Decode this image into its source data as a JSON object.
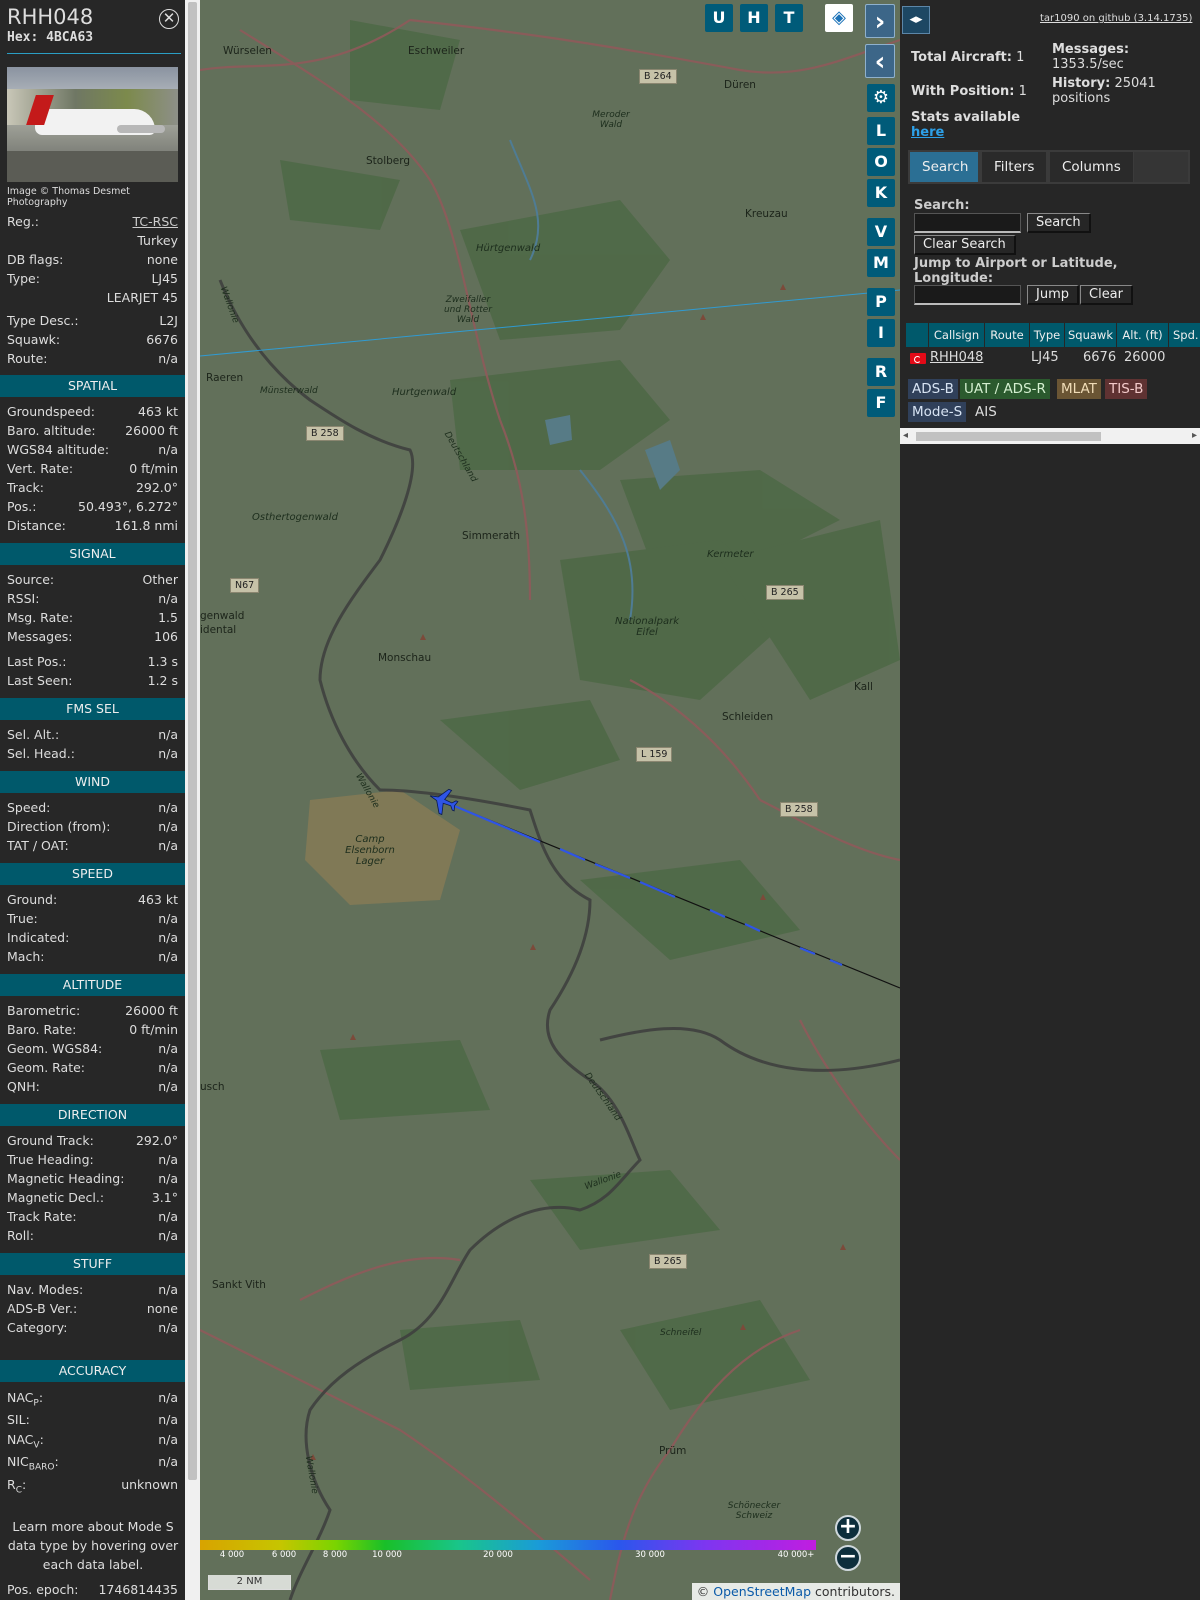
{
  "left_panel": {
    "callsign": "RHH048",
    "hex": "Hex: 4BCA63",
    "close_glyph": "✕",
    "photo_credit": "Image © Thomas Desmet Photography",
    "reg_label": "Reg.:",
    "reg_value": "TC-RSC",
    "country": "Turkey",
    "dbflags_label": "DB flags:",
    "dbflags_value": "none",
    "type_label": "Type:",
    "type_value": "LJ45",
    "type_name": "LEARJET 45",
    "typedesc_label": "Type Desc.:",
    "typedesc_value": "L2J",
    "squawk_label": "Squawk:",
    "squawk_value": "6676",
    "route_label": "Route:",
    "route_value": "n/a",
    "sections": {
      "spatial": "SPATIAL",
      "signal": "SIGNAL",
      "fms": "FMS SEL",
      "wind": "WIND",
      "speed": "SPEED",
      "altitude": "ALTITUDE",
      "direction": "DIRECTION",
      "stuff": "STUFF",
      "accuracy": "ACCURACY"
    },
    "spatial": {
      "gs_l": "Groundspeed:",
      "gs_v": "463 kt",
      "baro_l": "Baro. altitude:",
      "baro_v": "26000 ft",
      "wgs_l": "WGS84 altitude:",
      "wgs_v": "n/a",
      "vr_l": "Vert. Rate:",
      "vr_v": "0 ft/min",
      "track_l": "Track:",
      "track_v": "292.0°",
      "pos_l": "Pos.:",
      "pos_v": "50.493°, 6.272°",
      "dist_l": "Distance:",
      "dist_v": "161.8 nmi"
    },
    "signal": {
      "src_l": "Source:",
      "src_v": "Other",
      "rssi_l": "RSSI:",
      "rssi_v": "n/a",
      "msgrate_l": "Msg. Rate:",
      "msgrate_v": "1.5",
      "msgs_l": "Messages:",
      "msgs_v": "106",
      "lastpos_l": "Last Pos.:",
      "lastpos_v": "1.3 s",
      "lastseen_l": "Last Seen:",
      "lastseen_v": "1.2 s"
    },
    "fms": {
      "selalt_l": "Sel. Alt.:",
      "selalt_v": "n/a",
      "selhead_l": "Sel. Head.:",
      "selhead_v": "n/a"
    },
    "wind": {
      "speed_l": "Speed:",
      "speed_v": "n/a",
      "dir_l": "Direction (from):",
      "dir_v": "n/a",
      "tat_l": "TAT / OAT:",
      "tat_v": "n/a"
    },
    "speed": {
      "ground_l": "Ground:",
      "ground_v": "463 kt",
      "true_l": "True:",
      "true_v": "n/a",
      "ind_l": "Indicated:",
      "ind_v": "n/a",
      "mach_l": "Mach:",
      "mach_v": "n/a"
    },
    "altitude": {
      "baro_l": "Barometric:",
      "baro_v": "26000 ft",
      "barorate_l": "Baro. Rate:",
      "barorate_v": "0 ft/min",
      "geom_l": "Geom. WGS84:",
      "geom_v": "n/a",
      "geomrate_l": "Geom. Rate:",
      "geomrate_v": "n/a",
      "qnh_l": "QNH:",
      "qnh_v": "n/a"
    },
    "direction": {
      "gt_l": "Ground Track:",
      "gt_v": "292.0°",
      "th_l": "True Heading:",
      "th_v": "n/a",
      "mh_l": "Magnetic Heading:",
      "mh_v": "n/a",
      "md_l": "Magnetic Decl.:",
      "md_v": "3.1°",
      "tr_l": "Track Rate:",
      "tr_v": "n/a",
      "roll_l": "Roll:",
      "roll_v": "n/a"
    },
    "stuff": {
      "nav_l": "Nav. Modes:",
      "nav_v": "n/a",
      "adsb_l": "ADS-B Ver.:",
      "adsb_v": "none",
      "cat_l": "Category:",
      "cat_v": "n/a"
    },
    "accuracy": {
      "nacp_base": "NAC",
      "nacp_sub": "P",
      "nacp_v": "n/a",
      "sil_l": "SIL:",
      "sil_v": "n/a",
      "nacv_base": "NAC",
      "nacv_sub": "V",
      "nacv_v": "n/a",
      "nic_base": "NIC",
      "nic_sub": "BARO",
      "nic_v": "n/a",
      "rc_base": "R",
      "rc_sub": "C",
      "rc_v": "unknown"
    },
    "note": "Learn more about Mode S data type by hovering over each data label.",
    "epoch_l": "Pos. epoch:",
    "epoch_v": "1746814435"
  },
  "map": {
    "buttons": {
      "u": "U",
      "h": "H",
      "t": "T",
      "l": "L",
      "o": "O",
      "k": "K",
      "v": "V",
      "m": "M",
      "p": "P",
      "i": "I",
      "r": "R",
      "f": "F"
    },
    "expand_glyph": "›",
    "collapse_glyph": "‹",
    "settings_glyph": "⚙",
    "layers_glyph": "◈",
    "zoom_in": "+",
    "zoom_out": "−",
    "places": {
      "wurselen": "Würselen",
      "eschweiler": "Eschweiler",
      "duren": "Düren",
      "stolberg": "Stolberg",
      "kreuzau": "Kreuzau",
      "raeren": "Raeren",
      "simmerath": "Simmerath",
      "monschau": "Monschau",
      "schleiden": "Schleiden",
      "kall": "Kall",
      "sankt_vith": "Sankt Vith",
      "prum": "Prüm",
      "hurtgenwald": "Hürtgenwald",
      "hurtgenwald2": "Hurtgenwald",
      "kermeter": "Kermeter",
      "nationalpark": "Nationalpark Eifel",
      "osthertogenwald": "Osthertogenwald",
      "camp": "Camp Elsenborn Lager",
      "zweifaller": "Zweifaller und Rotter Wald",
      "munsterwald": "Münsterwald",
      "merode": "Meroder Wald",
      "schneifel": "Schneifel",
      "schonecker": "Schönecker Schweiz",
      "deutschland1": "Deutschland",
      "deutschland2": "Deutschland",
      "wallonie1": "Wallonie",
      "wallonie2": "Wallonie",
      "wallonie3": "Wallonie",
      "wallonie4": "Wallonie",
      "genwald": "genwald",
      "idental": "idental",
      "usch": "usch"
    },
    "roads": {
      "b264": "B 264",
      "b258a": "B 258",
      "n67": "N67",
      "b265a": "B 265",
      "l159": "L 159",
      "b258b": "B 258",
      "b265b": "B 265"
    },
    "altitude_ticks": [
      "4 000",
      "6 000",
      "8 000",
      "10 000",
      "20 000",
      "30 000",
      "40 000+"
    ],
    "scale": "2 NM",
    "attribution_prefix": "© ",
    "attribution_link": "OpenStreetMap",
    "attribution_suffix": " contributors."
  },
  "right_panel": {
    "toggle_glyph": "◂▸",
    "github": "tar1090 on github (3.14.1735)",
    "total_aircraft": "Total Aircraft:",
    "total_aircraft_v": "1",
    "with_position": "With Position:",
    "with_position_v": "1",
    "messages_l": "Messages:",
    "messages_v": "1353.5/sec",
    "history_l": "History:",
    "history_v": "25041 positions",
    "stats_l": "Stats available",
    "stats_link": "here",
    "tabs": [
      "Search",
      "Filters",
      "Columns"
    ],
    "search_label": "Search:",
    "search_button": "Search",
    "clear_search": "Clear Search",
    "jump_label": "Jump to Airport or Latitude, Longitude:",
    "jump_button": "Jump",
    "clear_button": "Clear",
    "columns": [
      "Callsign",
      "Route",
      "Type",
      "Squawk",
      "Alt. (ft)",
      "Spd."
    ],
    "row": {
      "callsign": "RHH048",
      "route": "",
      "type": "LJ45",
      "squawk": "6676",
      "alt": "26000"
    },
    "legend": [
      "ADS-B",
      "UAT / ADS-R",
      "MLAT",
      "TIS-B",
      "Mode-S",
      "AIS"
    ]
  },
  "colors": {
    "section": "#00596b",
    "track_blue": "#2f55e6",
    "accent_link": "#2da0e8"
  }
}
